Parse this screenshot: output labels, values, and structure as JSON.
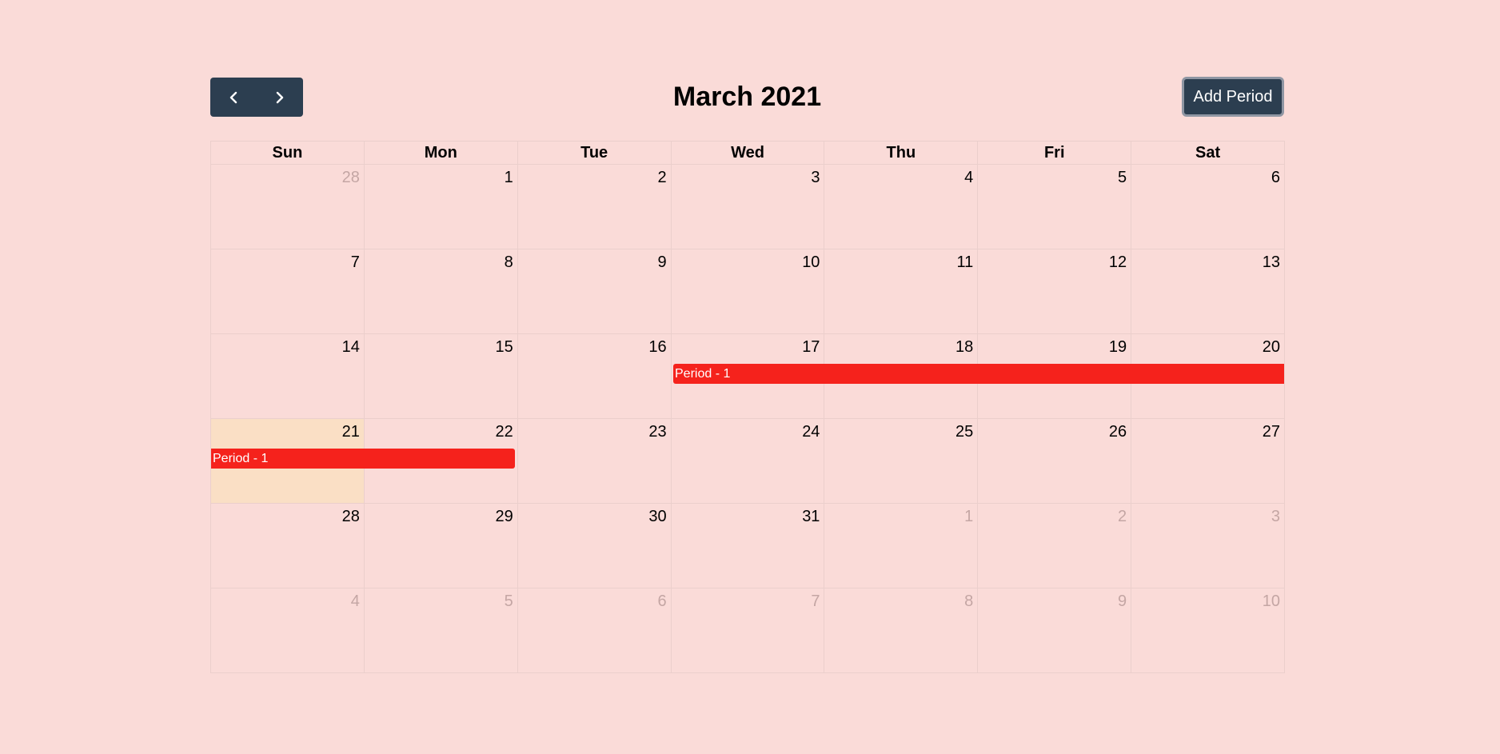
{
  "toolbar": {
    "title": "March 2021",
    "add_label": "Add Period",
    "prev_icon": "chevron-left-icon",
    "next_icon": "chevron-right-icon"
  },
  "weekdays": [
    "Sun",
    "Mon",
    "Tue",
    "Wed",
    "Thu",
    "Fri",
    "Sat"
  ],
  "weeks": [
    [
      "28",
      "1",
      "2",
      "3",
      "4",
      "5",
      "6"
    ],
    [
      "7",
      "8",
      "9",
      "10",
      "11",
      "12",
      "13"
    ],
    [
      "14",
      "15",
      "16",
      "17",
      "18",
      "19",
      "20"
    ],
    [
      "21",
      "22",
      "23",
      "24",
      "25",
      "26",
      "27"
    ],
    [
      "28",
      "29",
      "30",
      "31",
      "1",
      "2",
      "3"
    ],
    [
      "4",
      "5",
      "6",
      "7",
      "8",
      "9",
      "10"
    ]
  ],
  "events": [
    {
      "label": "Period - 1"
    },
    {
      "label": "Period - 1"
    }
  ],
  "colors": {
    "background": "#fadbd8",
    "toolbar_button": "#2c3e50",
    "event": "#f5221c",
    "today": "#fadfc5",
    "other_month_text": "#c4a6a4"
  }
}
